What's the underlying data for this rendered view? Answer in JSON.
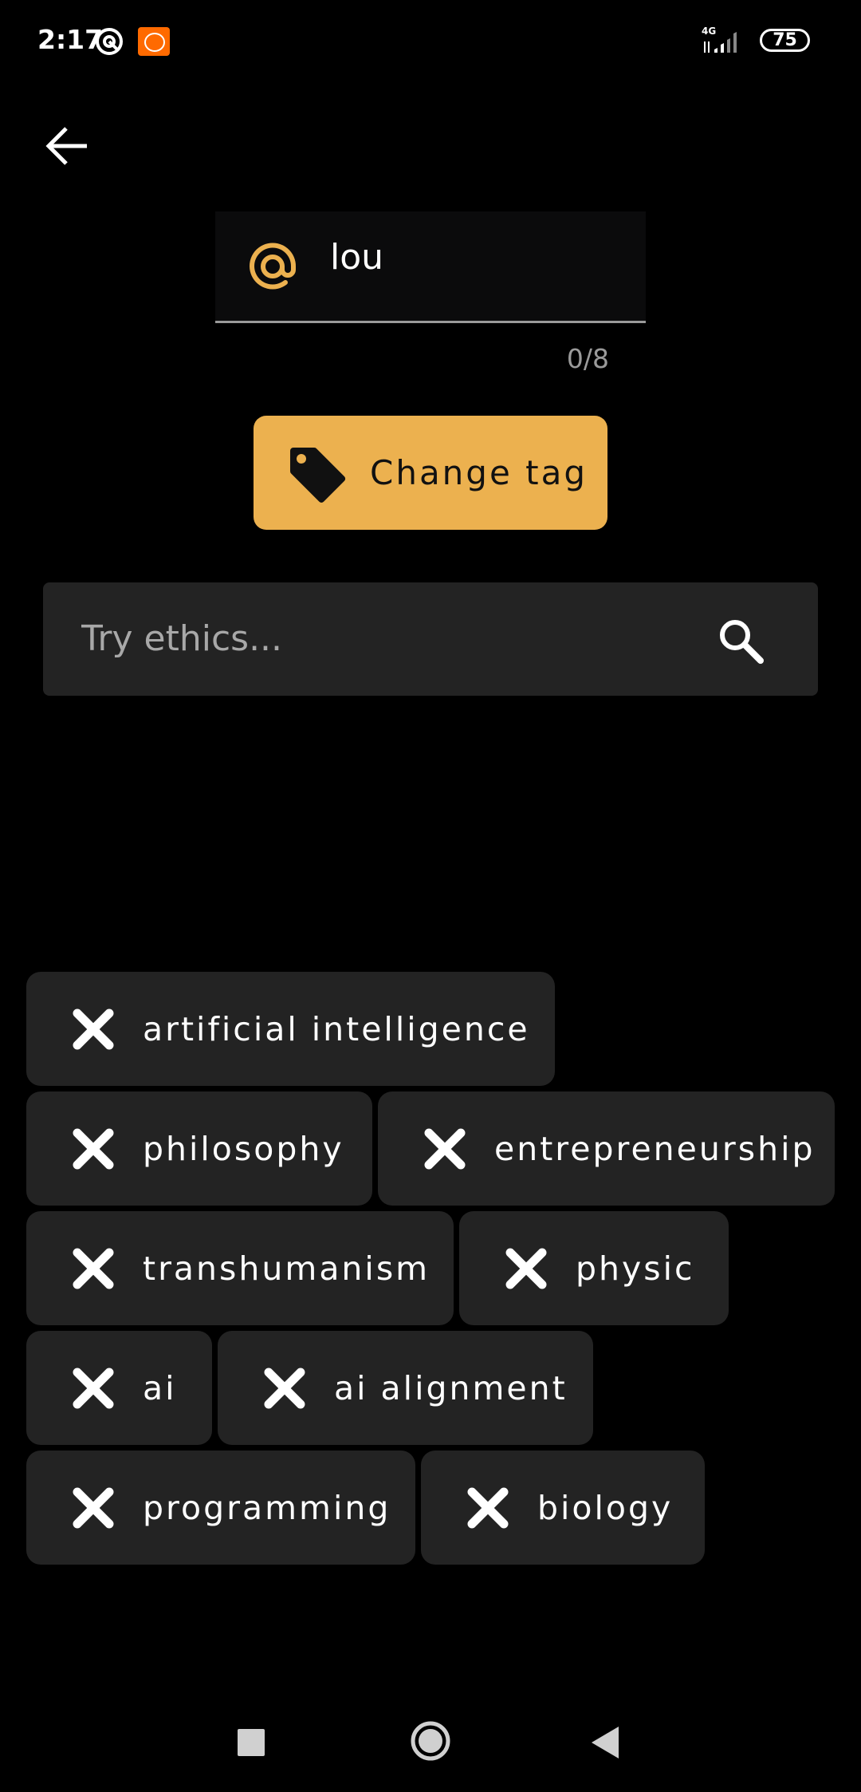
{
  "status_bar": {
    "time": "2:17",
    "network": "4G",
    "battery": "75"
  },
  "tag_input": {
    "value": "lou",
    "counter": "0/8"
  },
  "change_tag_button": {
    "label": "Change tag"
  },
  "search": {
    "placeholder": "Try ethics..."
  },
  "chips": {
    "rows": [
      [
        "artificial intelligence"
      ],
      [
        "philosophy",
        "entrepreneurship"
      ],
      [
        "transhumanism",
        "physic"
      ],
      [
        "ai",
        "ai alignment"
      ],
      [
        "programming",
        "biology"
      ]
    ]
  },
  "colors": {
    "accent": "#ecb14f",
    "surface": "#232323",
    "background": "#000000"
  }
}
